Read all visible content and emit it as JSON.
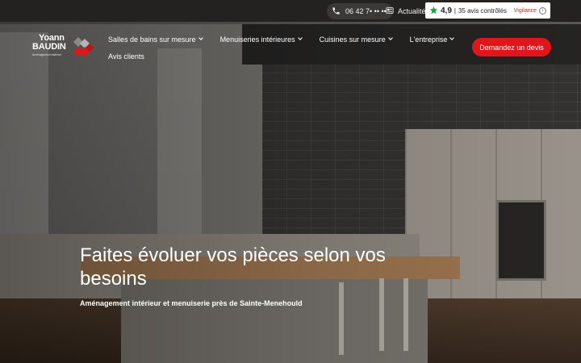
{
  "topbar": {
    "phone": "06 42 7• •• ••",
    "news_label": "Actualités",
    "rating": {
      "score": "4,9",
      "separator": "|",
      "reviews": "35 avis contrôlés",
      "vigilance": "Vigilance",
      "info": "i"
    }
  },
  "logo": {
    "line1": "Yoann",
    "line2": "BAUDIN",
    "tagline": "Aménagement intérieur"
  },
  "nav": {
    "items": [
      {
        "label": "Salles de bains sur mesure"
      },
      {
        "label": "Menuiseries intérieures"
      },
      {
        "label": "Cuisines sur mesure"
      },
      {
        "label": "L'entreprise"
      },
      {
        "label": "Avis clients"
      }
    ],
    "cta": "Demandez un devis"
  },
  "hero": {
    "title": "Faites évoluer vos pièces selon vos besoins",
    "subtitle": "Aménagement intérieur et menuiserie près de Sainte-Menehould"
  },
  "colors": {
    "accent": "#e0161b",
    "topbar": "#232221",
    "rating_star": "#1aa34a"
  },
  "icons": {
    "phone": "phone-icon",
    "news": "newspaper-icon",
    "star": "star-icon",
    "chevron": "chevron-down-icon"
  }
}
